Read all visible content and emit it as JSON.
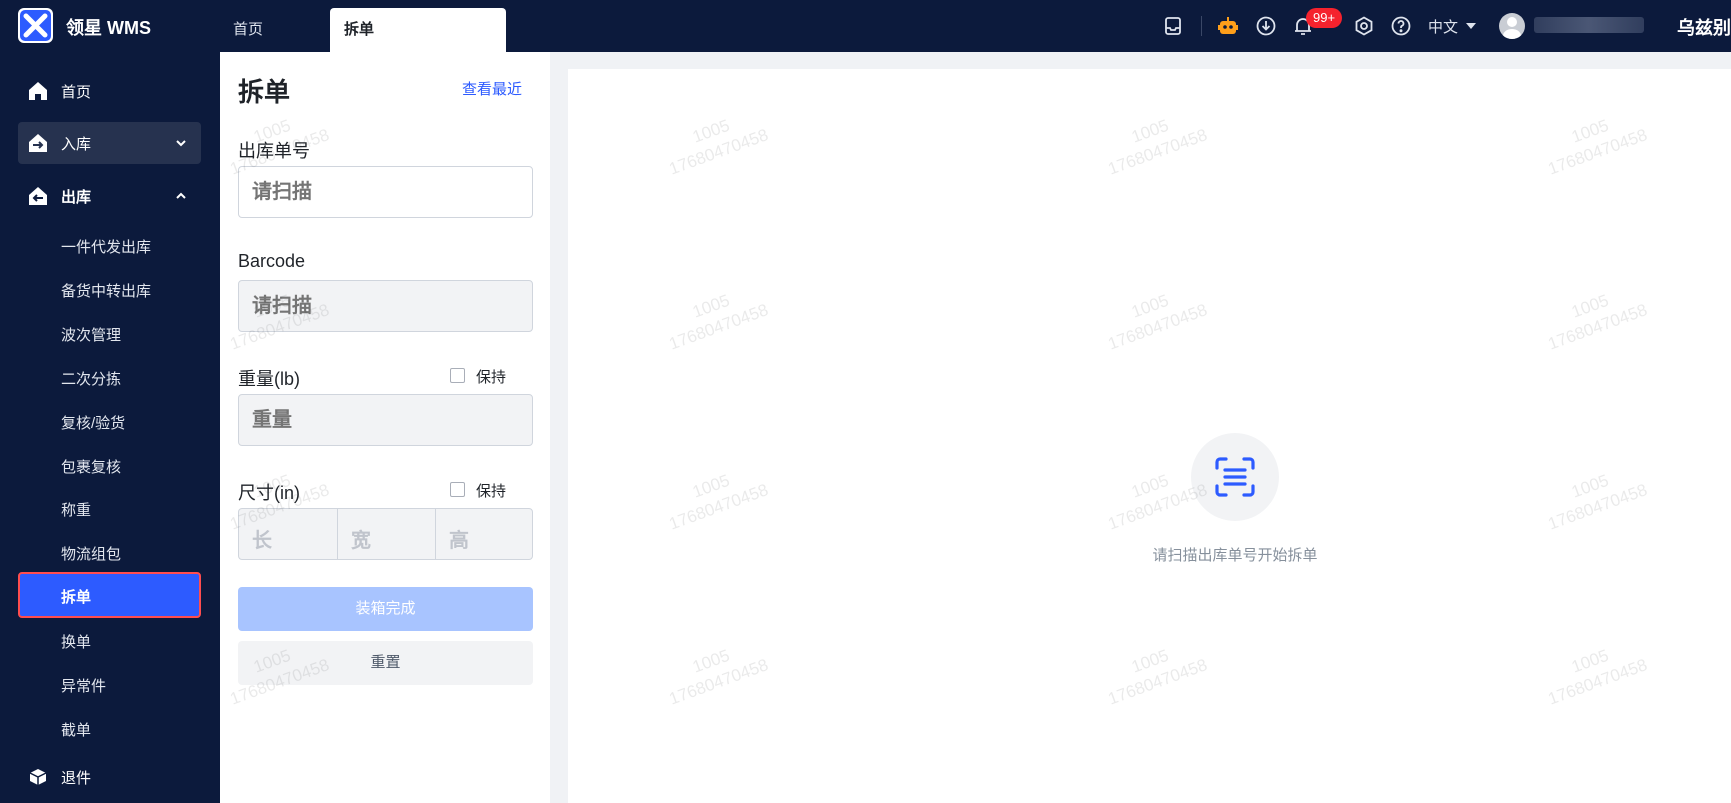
{
  "header": {
    "brand": "领星 WMS",
    "tabs": [
      {
        "label": "首页"
      },
      {
        "label": "拆单"
      }
    ],
    "notification_count": "99+",
    "language": "中文",
    "user_name_tail": "乌兹别"
  },
  "sidebar": {
    "items": [
      {
        "label": "首页"
      },
      {
        "label": "入库"
      },
      {
        "label": "出库"
      }
    ],
    "outbound_subitems": [
      {
        "label": "一件代发出库"
      },
      {
        "label": "备货中转出库"
      },
      {
        "label": "波次管理"
      },
      {
        "label": "二次分拣"
      },
      {
        "label": "复核/验货"
      },
      {
        "label": "包裹复核"
      },
      {
        "label": "称重"
      },
      {
        "label": "物流组包"
      },
      {
        "label": "拆单"
      },
      {
        "label": "换单"
      },
      {
        "label": "异常件"
      },
      {
        "label": "截单"
      }
    ],
    "returns": {
      "label": "退件"
    }
  },
  "form": {
    "title": "拆单",
    "recent_link": "查看最近",
    "order_no": {
      "label": "出库单号",
      "placeholder": "请扫描"
    },
    "barcode": {
      "label": "Barcode",
      "placeholder": "请扫描"
    },
    "weight": {
      "label": "重量(lb)",
      "placeholder": "重量",
      "keep_label": "保持"
    },
    "size": {
      "label": "尺寸(in)",
      "keep_label": "保持",
      "length_placeholder": "长",
      "width_placeholder": "宽",
      "height_placeholder": "高"
    },
    "finish_button": "装箱完成",
    "reset_button": "重置"
  },
  "main": {
    "empty_text": "请扫描出库单号开始拆单"
  },
  "watermark": {
    "line1": "1005",
    "line2": "17680470458"
  },
  "colors": {
    "nav_bg": "#0c1a3c",
    "accent": "#2d5bff",
    "badge": "#f5222d",
    "active_outline": "#ff4d4f"
  }
}
